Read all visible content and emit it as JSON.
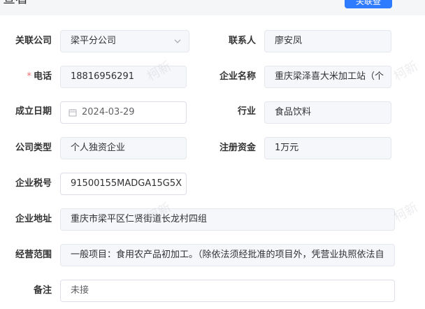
{
  "header": {
    "title": "查看",
    "primary_button": "关联查"
  },
  "form": {
    "company": {
      "label": "关联公司",
      "value": "梁平分公司"
    },
    "contact": {
      "label": "联系人",
      "value": "廖安凤"
    },
    "phone": {
      "required_mark": "*",
      "label": "电话",
      "value": "18816956291"
    },
    "enterprise_name": {
      "label": "企业名称",
      "value": "重庆梁泽喜大米加工站（个"
    },
    "established": {
      "label": "成立日期",
      "value": "2024-03-29"
    },
    "industry": {
      "label": "行业",
      "value": "食品饮料"
    },
    "company_type": {
      "label": "公司类型",
      "value": "个人独资企业"
    },
    "capital": {
      "label": "注册资金",
      "value": "1万元"
    },
    "tax_id": {
      "label": "企业税号",
      "value": "91500155MADGA15G5X"
    },
    "address": {
      "label": "企业地址",
      "value": "重庆市梁平区仁贤街道长龙村四组"
    },
    "scope": {
      "label": "经营范围",
      "value": "一般项目：食用农产品初加工。（除依法须经批准的项目外，凭营业执照依法自"
    },
    "remark": {
      "label": "备注",
      "value": "未接"
    }
  },
  "watermark": "柯新",
  "colors": {
    "accent": "#2f7bff",
    "required": "#f56c6c",
    "readonly_bg": "#f5f7fa"
  },
  "icons": {
    "company_select": "chevron-down-icon",
    "date": "calendar-icon"
  }
}
